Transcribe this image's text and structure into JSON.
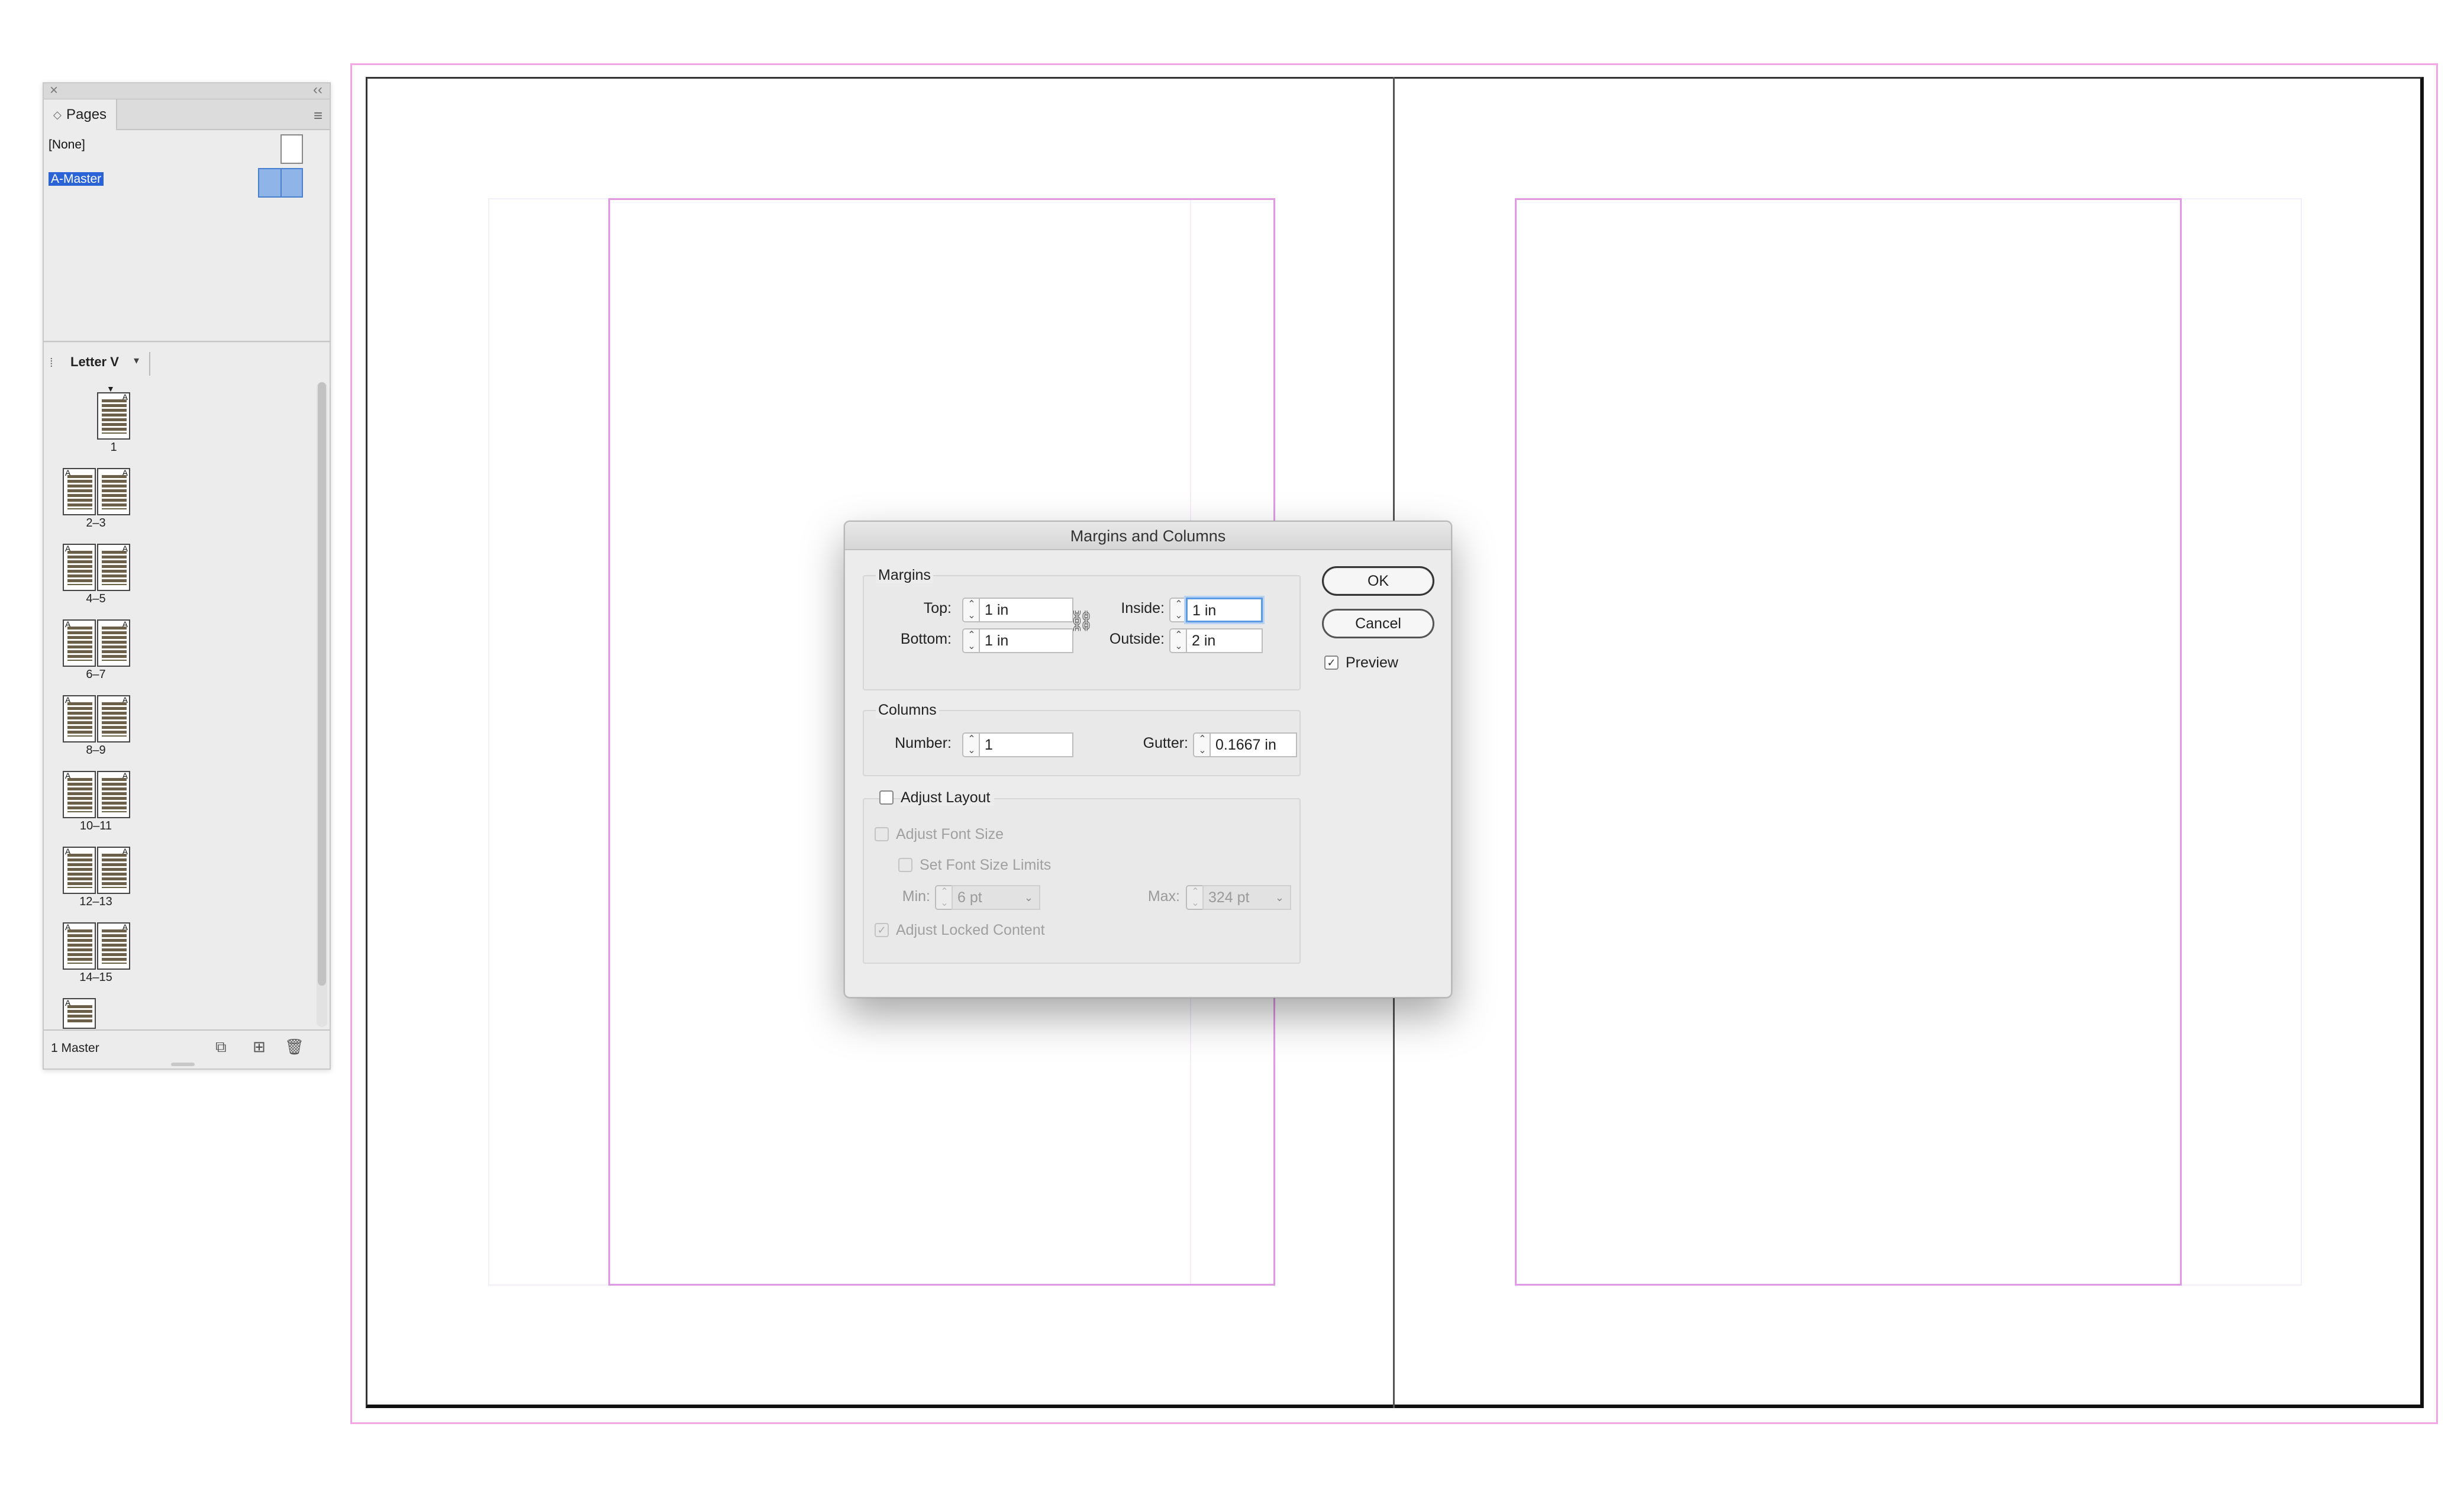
{
  "pages_panel": {
    "tab_label": "Pages",
    "masters": [
      {
        "label": "[None]"
      },
      {
        "label": "A-Master"
      }
    ],
    "page_size": "Letter V",
    "pages": [
      {
        "label": "1"
      },
      {
        "label": "2–3"
      },
      {
        "label": "4–5"
      },
      {
        "label": "6–7"
      },
      {
        "label": "8–9"
      },
      {
        "label": "10–11"
      },
      {
        "label": "12–13"
      },
      {
        "label": "14–15"
      }
    ],
    "footer_text": "1 Master"
  },
  "dialog": {
    "title": "Margins and Columns",
    "margins": {
      "group_label": "Margins",
      "top_label": "Top:",
      "top_value": "1 in",
      "bottom_label": "Bottom:",
      "bottom_value": "1 in",
      "inside_label": "Inside:",
      "inside_value": "1 in",
      "outside_label": "Outside:",
      "outside_value": "2 in"
    },
    "columns": {
      "group_label": "Columns",
      "number_label": "Number:",
      "number_value": "1",
      "gutter_label": "Gutter:",
      "gutter_value": "0.1667 in"
    },
    "adjust": {
      "adjust_layout_label": "Adjust Layout",
      "adjust_layout_checked": false,
      "adjust_font_size_label": "Adjust Font Size",
      "set_font_limits_label": "Set Font Size Limits",
      "min_label": "Min:",
      "min_value": "6 pt",
      "max_label": "Max:",
      "max_value": "324 pt",
      "adjust_locked_label": "Adjust Locked Content",
      "adjust_locked_checked": true
    },
    "buttons": {
      "ok": "OK",
      "cancel": "Cancel"
    },
    "preview_label": "Preview",
    "preview_checked": true
  }
}
